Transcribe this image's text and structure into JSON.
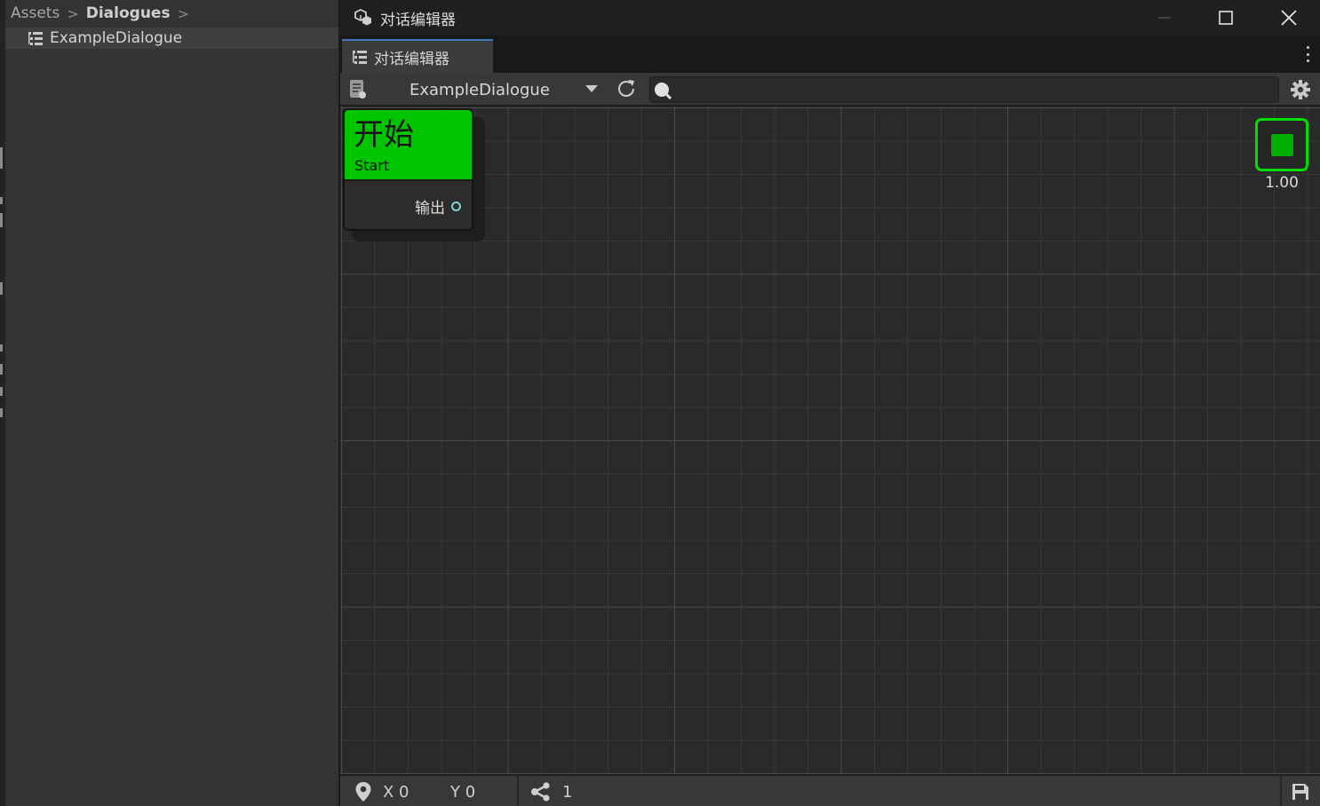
{
  "project_panel": {
    "breadcrumb": [
      "Assets",
      "Dialogues"
    ],
    "asset_item": "ExampleDialogue"
  },
  "window": {
    "title": "对话编辑器",
    "icon": "unity-cubes-icon",
    "controls": [
      "minimize-icon",
      "maximize-icon",
      "close-icon"
    ]
  },
  "tab": {
    "label": "对话编辑器",
    "icon": "list-icon",
    "menu_icon": "vertical-dots-icon"
  },
  "toolbar": {
    "dialogue_selected": "ExampleDialogue",
    "search_placeholder": "",
    "icons": [
      "document-icon",
      "refresh-icon",
      "search-icon",
      "gear-icon"
    ]
  },
  "graph": {
    "nodes": [
      {
        "title": "开始",
        "subtitle": "Start",
        "output_label": "输出",
        "header_color": "#00c400"
      }
    ],
    "zoom_level": "1.00",
    "zoom_accent_color": "#00dd00"
  },
  "status": {
    "x_label": "X 0",
    "y_label": "Y 0",
    "node_count": "1",
    "icons": [
      "map-pin-icon",
      "share-icon",
      "save-icon"
    ]
  }
}
